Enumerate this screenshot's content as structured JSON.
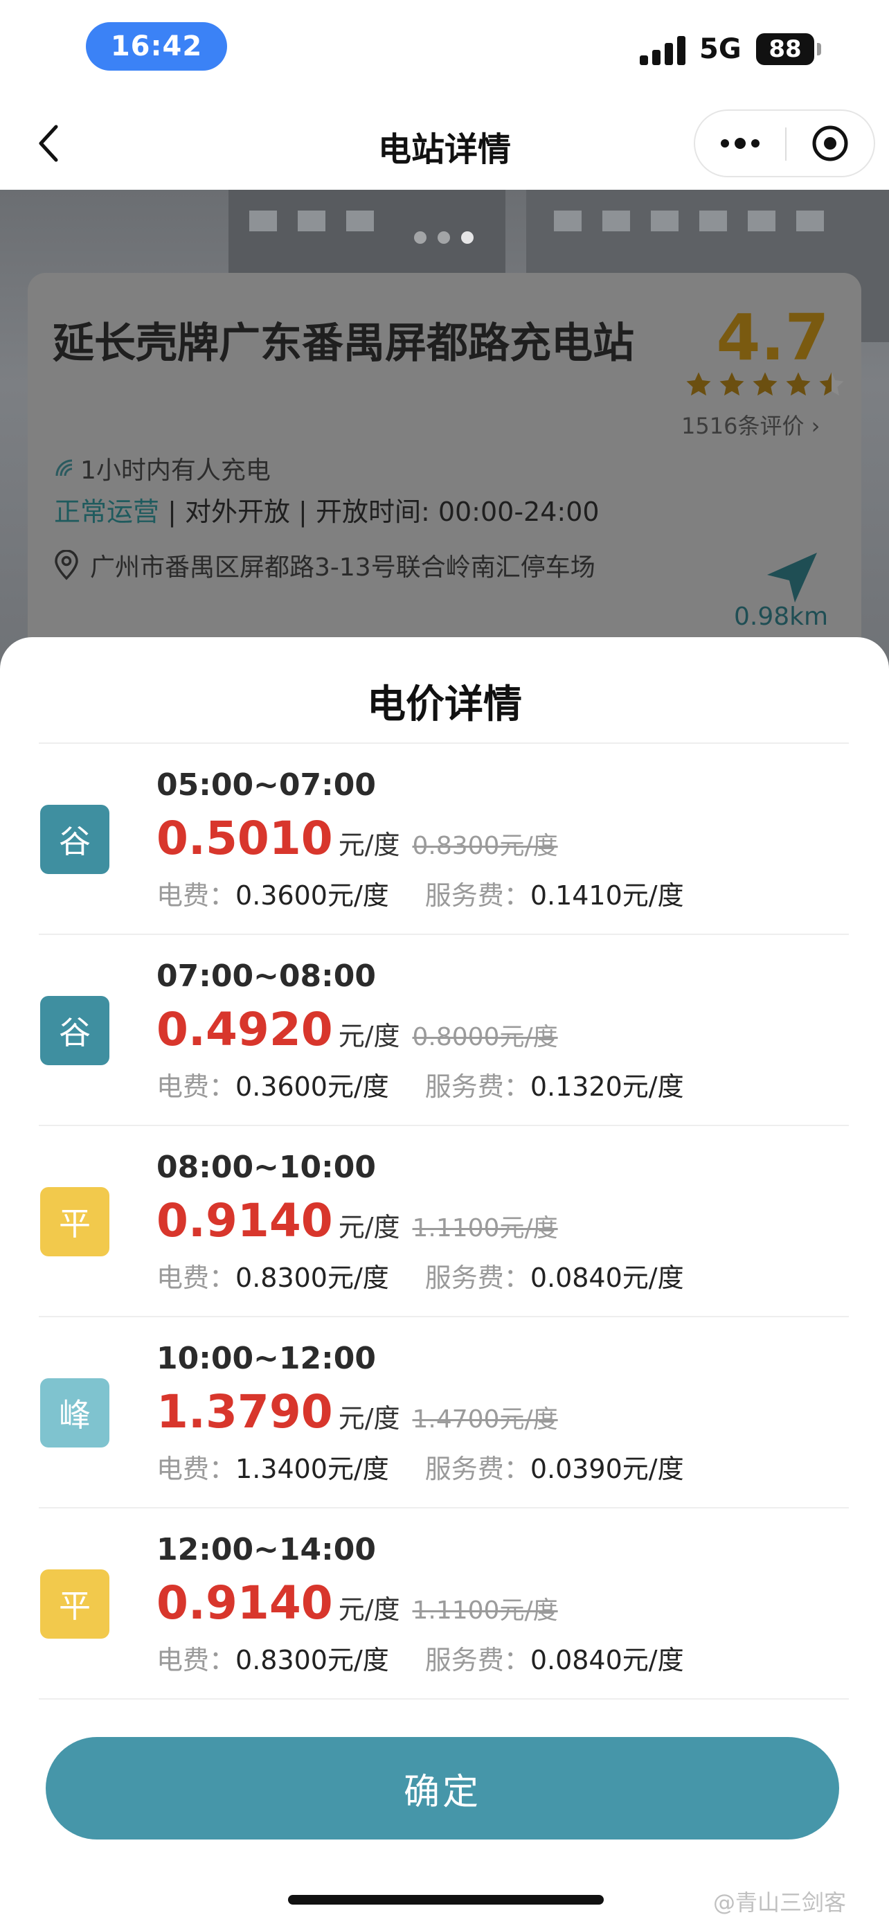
{
  "status_bar": {
    "time": "16:42",
    "network": "5G",
    "battery": "88"
  },
  "nav": {
    "title": "电站详情"
  },
  "station": {
    "name": "延长壳牌广东番禺屏都路充电站",
    "rating": "4.7",
    "stars": 4.5,
    "reviews": "1516条评价",
    "recent_activity": "1小时内有人充电",
    "status": "正常运营",
    "status_rest": " | 对外开放 | 开放时间: 00:00-24:00",
    "address": "广州市番禺区屏都路3-13号联合岭南汇停车场",
    "distance": "0.98km"
  },
  "sheet": {
    "title": "电价详情",
    "labels": {
      "elec": "电费：",
      "service": "服务费："
    },
    "tiers": [
      {
        "badge": "谷",
        "badge_color": "#3f8fa0",
        "time": "05:00~07:00",
        "price": "0.5010",
        "unit": "元/度",
        "original": "0.8300元/度",
        "elec_fee": "0.3600元/度",
        "service_fee": "0.1410元/度"
      },
      {
        "badge": "谷",
        "badge_color": "#3f8fa0",
        "time": "07:00~08:00",
        "price": "0.4920",
        "unit": "元/度",
        "original": "0.8000元/度",
        "elec_fee": "0.3600元/度",
        "service_fee": "0.1320元/度"
      },
      {
        "badge": "平",
        "badge_color": "#f2c94c",
        "time": "08:00~10:00",
        "price": "0.9140",
        "unit": "元/度",
        "original": "1.1100元/度",
        "elec_fee": "0.8300元/度",
        "service_fee": "0.0840元/度"
      },
      {
        "badge": "峰",
        "badge_color": "#7fc3cf",
        "time": "10:00~12:00",
        "price": "1.3790",
        "unit": "元/度",
        "original": "1.4700元/度",
        "elec_fee": "1.3400元/度",
        "service_fee": "0.0390元/度"
      },
      {
        "badge": "平",
        "badge_color": "#f2c94c",
        "time": "12:00~14:00",
        "price": "0.9140",
        "unit": "元/度",
        "original": "1.1100元/度",
        "elec_fee": "0.8300元/度",
        "service_fee": "0.0840元/度"
      }
    ],
    "confirm": "确定"
  },
  "watermark": "@青山三剑客",
  "colors": {
    "accent": "#4696a9",
    "price": "#d8362c",
    "peak": "#7fc3cf",
    "valley": "#3f8fa0",
    "flat": "#f2c94c"
  }
}
